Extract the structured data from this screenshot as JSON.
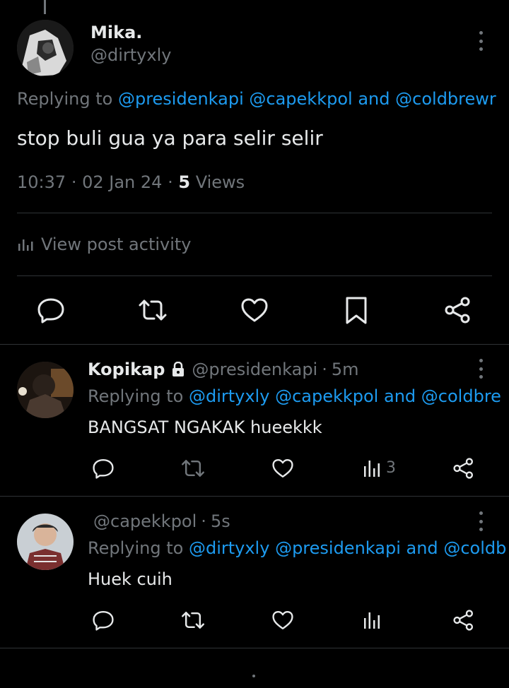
{
  "main_post": {
    "display_name": "Mika.",
    "handle": "@dirtyxly",
    "replying_prefix": "Replying to",
    "replying_mentions": [
      "@presidenkapi",
      "@capekkpol"
    ],
    "replying_and": "and",
    "replying_last": "@coldbrewr",
    "text": "stop buli gua ya para selir selir",
    "time": "10:37",
    "date": "02 Jan 24",
    "views_count": "5",
    "views_label": "Views",
    "activity_label": "View post activity"
  },
  "replies": [
    {
      "display_name": "Kopikap",
      "handle": "@presidenkapi",
      "age": "5m",
      "replying_prefix": "Replying to",
      "replying_mentions": [
        "@dirtyxly",
        "@capekkpol"
      ],
      "replying_and": "and",
      "replying_last": "@coldbre",
      "text": "BANGSAT NGAKAK hueekkk",
      "views_count": "3"
    },
    {
      "display_name": "",
      "handle": "@capekkpol",
      "age": "5s",
      "replying_prefix": "Replying to",
      "replying_mentions": [
        "@dirtyxly",
        "@presidenkapi"
      ],
      "replying_and": "and",
      "replying_last": "@coldb",
      "text": "Huek cuih",
      "views_count": ""
    }
  ],
  "separator": "·",
  "icons": {
    "lock": "lock-icon",
    "reply": "reply-icon",
    "repost": "repost-icon",
    "like": "like-icon",
    "bookmark": "bookmark-icon",
    "share": "share-icon",
    "views": "views-icon",
    "more": "more-icon"
  },
  "colors": {
    "background": "#000000",
    "text": "#e7e9ea",
    "muted": "#71767b",
    "link": "#1d9bf0",
    "divider": "#2f3336"
  }
}
